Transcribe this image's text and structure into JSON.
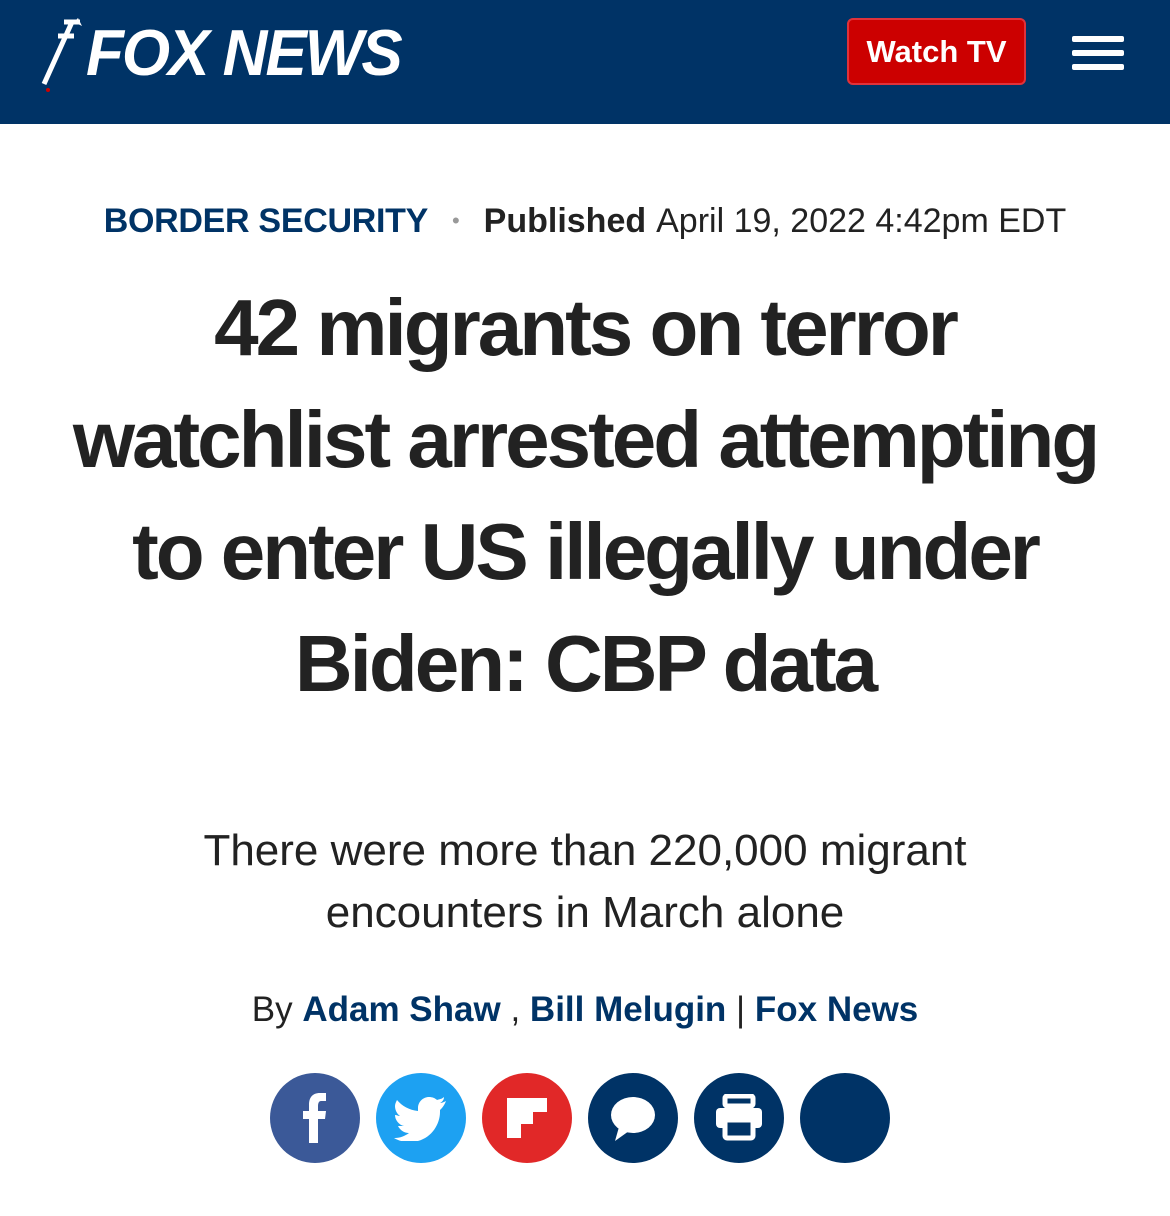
{
  "header": {
    "logo_text": "FOX NEWS",
    "watch_tv_label": "Watch TV",
    "menu_icon": "hamburger-menu-icon",
    "background_color": "#003366",
    "accent_color": "#cc0000"
  },
  "article": {
    "category": "BORDER SECURITY",
    "published_label": "Published",
    "published_date": "April 19, 2022 4:42pm EDT",
    "headline": "42 migrants on terror watchlist arrested attempting to enter US illegally under Biden: CBP data",
    "subheadline": "There were more than 220,000 migrant encounters in March alone",
    "byline": {
      "prefix": "By",
      "author1": "Adam Shaw",
      "comma": ",",
      "author2": "Bill Melugin",
      "separator": "|",
      "outlet": "Fox News"
    }
  },
  "share_buttons": [
    {
      "icon": "facebook-icon",
      "color": "#3b5998"
    },
    {
      "icon": "twitter-icon",
      "color": "#1da1f2"
    },
    {
      "icon": "flipboard-icon",
      "color": "#e12828"
    },
    {
      "icon": "comment-icon",
      "color": "#003366"
    },
    {
      "icon": "print-icon",
      "color": "#003366"
    },
    {
      "icon": "more-icon",
      "color": "#003366"
    }
  ]
}
